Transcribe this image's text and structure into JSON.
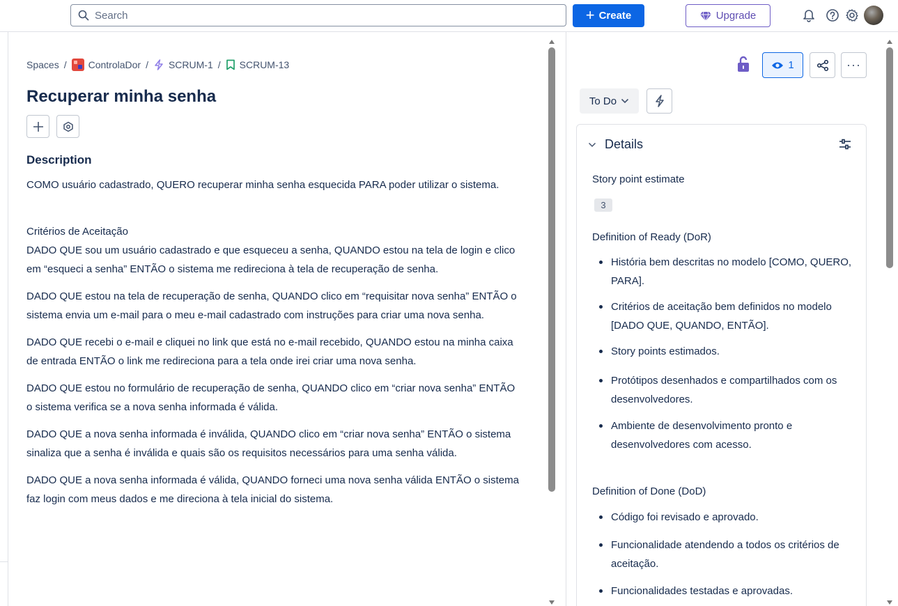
{
  "topbar": {
    "search_placeholder": "Search",
    "create_label": "Create",
    "upgrade_label": "Upgrade",
    "colors": {
      "create_bg": "#0c66e4",
      "upgrade_border": "#6e5dc6"
    }
  },
  "breadcrumb": {
    "spaces": "Spaces",
    "project": "ControlaDor",
    "epic": "SCRUM-1",
    "issue": "SCRUM-13"
  },
  "issue": {
    "title": "Recuperar minha senha",
    "description_heading": "Description",
    "intro": "COMO usuário cadastrado, QUERO recuperar minha senha esquecida PARA poder utilizar o sistema.",
    "criteria_heading": "Critérios de Aceitação",
    "criteria": [
      "DADO QUE sou um usuário cadastrado e que esqueceu a senha, QUANDO estou na tela de login e clico em “esqueci a senha” ENTÃO o sistema me redireciona à tela de recuperação de senha.",
      "DADO QUE estou na tela de recuperação de senha, QUANDO clico em “requisitar nova senha” ENTÃO o sistema envia um e-mail para o meu e-mail cadastrado com instruções para criar uma nova senha.",
      "DADO QUE recebi o e-mail e cliquei no link que está no e-mail recebido, QUANDO estou na minha caixa de entrada ENTÃO o link me redireciona para a tela onde irei criar uma nova senha.",
      "DADO QUE estou no formulário de recuperação de senha, QUANDO clico em “criar nova senha” ENTÃO o sistema verifica se a nova senha informada é válida.",
      "DADO QUE a nova senha informada é inválida, QUANDO clico em “criar nova senha” ENTÃO o sistema sinaliza que a senha é inválida e quais são os requisitos necessários para uma senha válida.",
      "DADO QUE a nova senha informada é válida, QUANDO forneci uma nova senha válida ENTÃO o sistema faz login com meus dados e me direciona à tela inicial do sistema."
    ]
  },
  "side": {
    "watch_count": "1",
    "status": "To Do",
    "details_title": "Details",
    "story_points_label": "Story point estimate",
    "story_points": "3",
    "dor_label": "Definition of Ready (DoR)",
    "dor_items": [
      "História bem descritas no modelo [COMO, QUERO, PARA].",
      "Critérios de aceitação bem definidos no modelo [DADO QUE, QUANDO, ENTÃO].",
      "Story points estimados.",
      "Protótipos desenhados e compartilhados com os desenvolvedores.",
      "Ambiente de desenvolvimento pronto e desenvolvedores com acesso."
    ],
    "dod_label": "Definition of Done (DoD)",
    "dod_items": [
      "Código foi revisado e aprovado.",
      "Funcionalidade atendendo a todos os critérios de aceitação.",
      "Funcionalidades testadas e aprovadas."
    ]
  }
}
